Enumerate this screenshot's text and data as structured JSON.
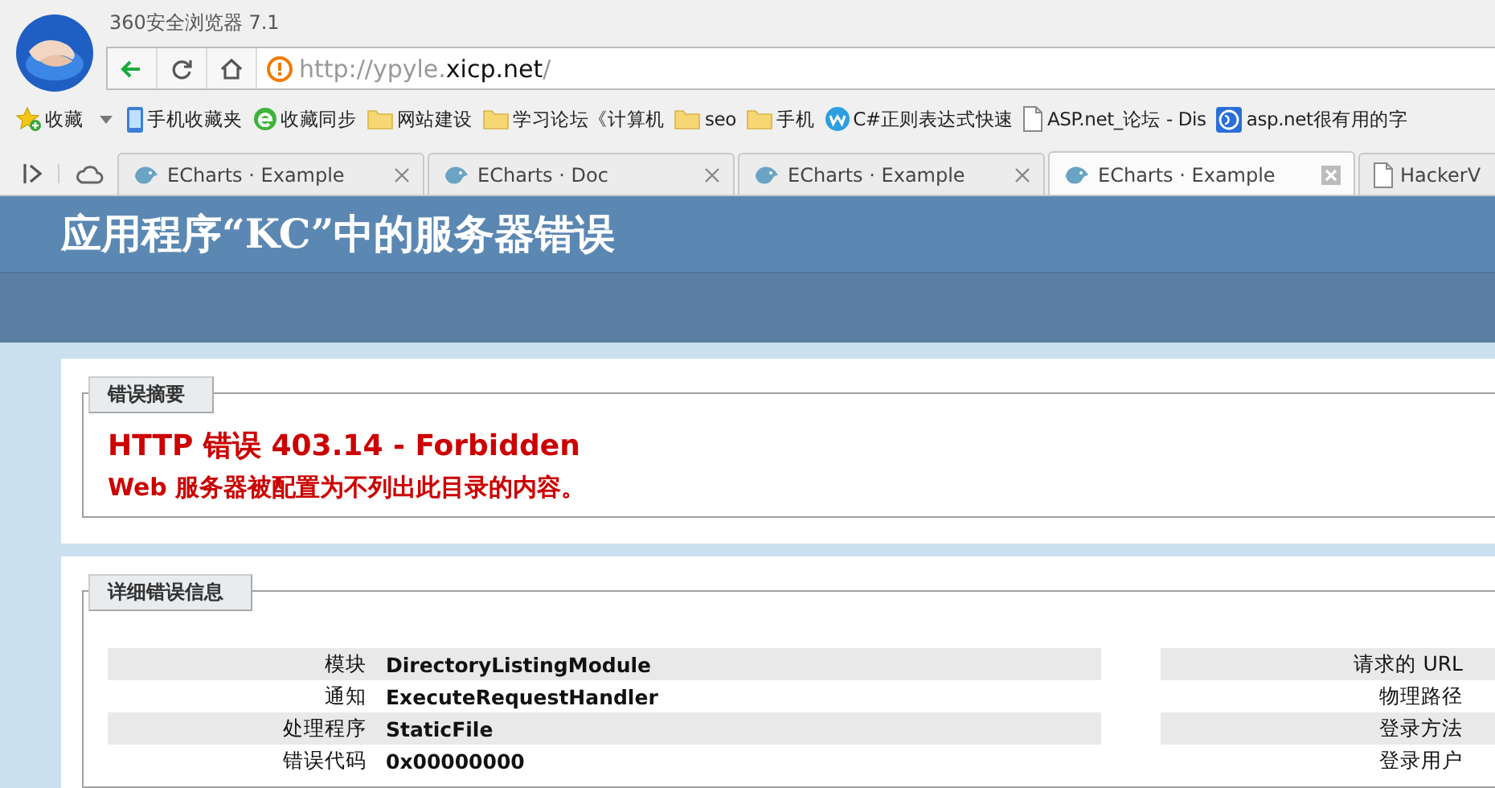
{
  "window": {
    "title": "360安全浏览器 7.1"
  },
  "address_bar": {
    "url_parts": [
      {
        "text": "http://ypyle.",
        "kind": "dim"
      },
      {
        "text": "xicp.net",
        "kind": "main"
      },
      {
        "text": "/",
        "kind": "dim"
      }
    ]
  },
  "bookmarks": [
    {
      "label": "收藏",
      "kind": "star"
    },
    {
      "label": "手机收藏夹",
      "kind": "phone"
    },
    {
      "label": "收藏同步",
      "kind": "sync"
    },
    {
      "label": "网站建设",
      "kind": "folder"
    },
    {
      "label": "学习论坛《计算机",
      "kind": "folder"
    },
    {
      "label": "seo",
      "kind": "folder"
    },
    {
      "label": "手机",
      "kind": "folder"
    },
    {
      "label": "C#正则表达式快速",
      "kind": "w"
    },
    {
      "label": "ASP.net_论坛 - Dis",
      "kind": "page"
    },
    {
      "label": "asp.net很有用的字",
      "kind": "globe"
    }
  ],
  "tabs": [
    {
      "label": "ECharts · Example",
      "selected": false,
      "kind": "bird"
    },
    {
      "label": "ECharts · Doc",
      "selected": false,
      "kind": "bird"
    },
    {
      "label": "ECharts · Example",
      "selected": false,
      "kind": "bird"
    },
    {
      "label": "ECharts · Example",
      "selected": true,
      "kind": "bird"
    },
    {
      "label": "HackerV",
      "selected": false,
      "kind": "page"
    }
  ],
  "page": {
    "title": "应用程序“KC”中的服务器错误",
    "summary": {
      "legend": "错误摘要",
      "heading": "HTTP 错误 403.14 - Forbidden",
      "message": "Web 服务器被配置为不列出此目录的内容。"
    },
    "details": {
      "legend": "详细错误信息",
      "left_rows": [
        {
          "label": "模块",
          "value": "DirectoryListingModule"
        },
        {
          "label": "通知",
          "value": "ExecuteRequestHandler"
        },
        {
          "label": "处理程序",
          "value": "StaticFile"
        },
        {
          "label": "错误代码",
          "value": "0x00000000"
        }
      ],
      "right_rows": [
        {
          "label": "请求的 URL"
        },
        {
          "label": "物理路径"
        },
        {
          "label": "登录方法"
        },
        {
          "label": "登录用户"
        }
      ]
    }
  }
}
